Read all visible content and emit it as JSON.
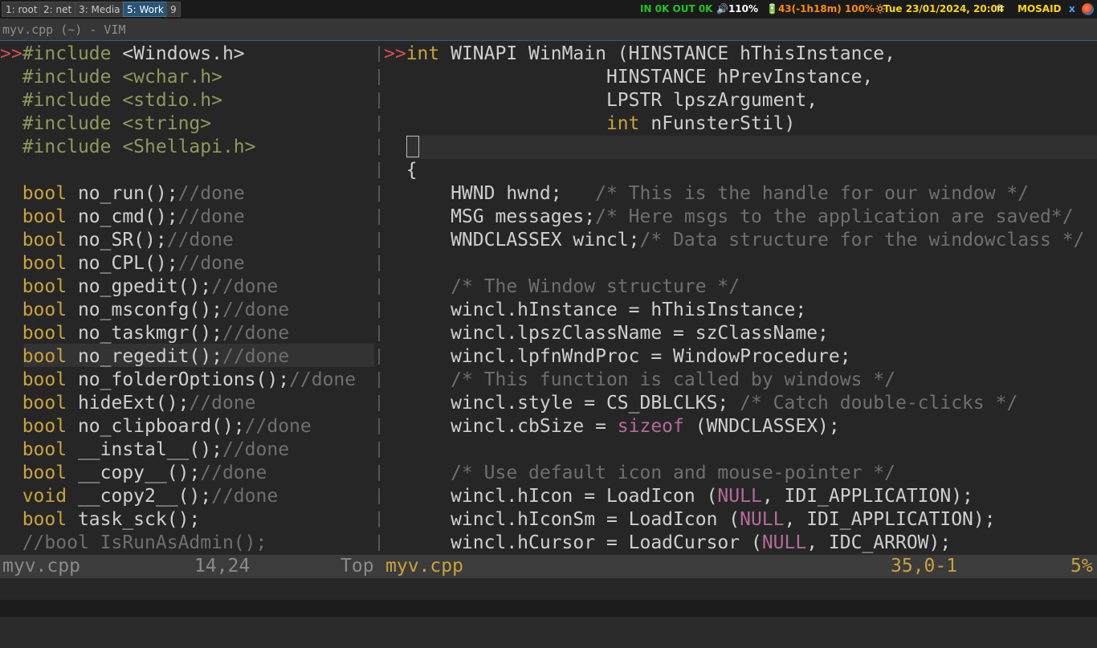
{
  "workspaces": [
    {
      "label": "1: root"
    },
    {
      "label": "2: net"
    },
    {
      "label": "3: Media"
    },
    {
      "label": "5: Work"
    },
    {
      "label": "9"
    }
  ],
  "status": {
    "net": "IN 0K OUT 0K",
    "volume": "🔊110%",
    "battery": "🔋43(-1h18m) 100%🔅",
    "datetime": "Tue 23/01/2024, 20:04",
    "lang": "fr",
    "user": "MOSAID",
    "close": "x"
  },
  "window": {
    "title": "myv.cpp (~) - VIM"
  },
  "left_pane": {
    "status_file": "myv.cpp",
    "status_pos": "14,24",
    "status_scroll": "Top"
  },
  "right_pane": {
    "status_file": "myv.cpp",
    "status_pos": "35,0-1",
    "status_scroll": "5%"
  },
  "colors": {
    "preprocessor": "#8e9a5a",
    "keyword": "#c9a33a",
    "comment": "#6f6f6f",
    "null": "#b56a9d",
    "gutter_marker": "#d24f4f",
    "text": "#cfcfcf",
    "active_workspace": "#285577",
    "status_green": "#1ec51e",
    "status_orange": "#ff8c00",
    "status_yellow": "#ffd700"
  }
}
